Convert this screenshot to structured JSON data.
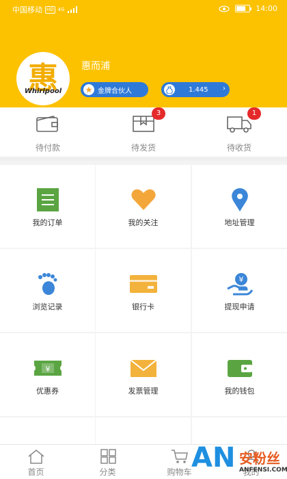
{
  "status_bar": {
    "carrier": "中国移动",
    "hd": "HD",
    "network": "4G",
    "battery": "68",
    "battery_level": 0.68,
    "time": "14:00"
  },
  "profile": {
    "avatar_char": "惠",
    "avatar_brand": "Whirlpool",
    "username": "惠而浦",
    "rank": "金牌合伙人",
    "coins": "1.445"
  },
  "orders": [
    {
      "label": "待付款",
      "badge": null
    },
    {
      "label": "待发货",
      "badge": "3"
    },
    {
      "label": "待收货",
      "badge": "1"
    }
  ],
  "menu": [
    {
      "label": "我的订单",
      "icon": "list-icon",
      "color": "#5aa542"
    },
    {
      "label": "我的关注",
      "icon": "heart-icon",
      "color": "#f3a73b"
    },
    {
      "label": "地址管理",
      "icon": "location-pin-icon",
      "color": "#3b86d8"
    },
    {
      "label": "浏览记录",
      "icon": "footprint-icon",
      "color": "#3b86d8"
    },
    {
      "label": "银行卡",
      "icon": "bank-card-icon",
      "color": "#f3b23b"
    },
    {
      "label": "提现申请",
      "icon": "withdraw-icon",
      "color": "#3b86d8"
    },
    {
      "label": "优惠券",
      "icon": "coupon-icon",
      "color": "#5aa542"
    },
    {
      "label": "发票管理",
      "icon": "envelope-icon",
      "color": "#f3b23b"
    },
    {
      "label": "我的钱包",
      "icon": "wallet-icon",
      "color": "#5aa542"
    }
  ],
  "tabs": [
    {
      "label": "首页",
      "icon": "home-icon"
    },
    {
      "label": "分类",
      "icon": "category-icon"
    },
    {
      "label": "购物车",
      "icon": "cart-icon"
    },
    {
      "label": "我的",
      "icon": "user-icon"
    }
  ],
  "watermark": {
    "logo": "AN",
    "name": "安粉丝",
    "url": "ANFENSI.COM"
  },
  "colors": {
    "brand": "#fcc200",
    "pill": "#2f7ad8",
    "badge": "#e42a2a"
  }
}
